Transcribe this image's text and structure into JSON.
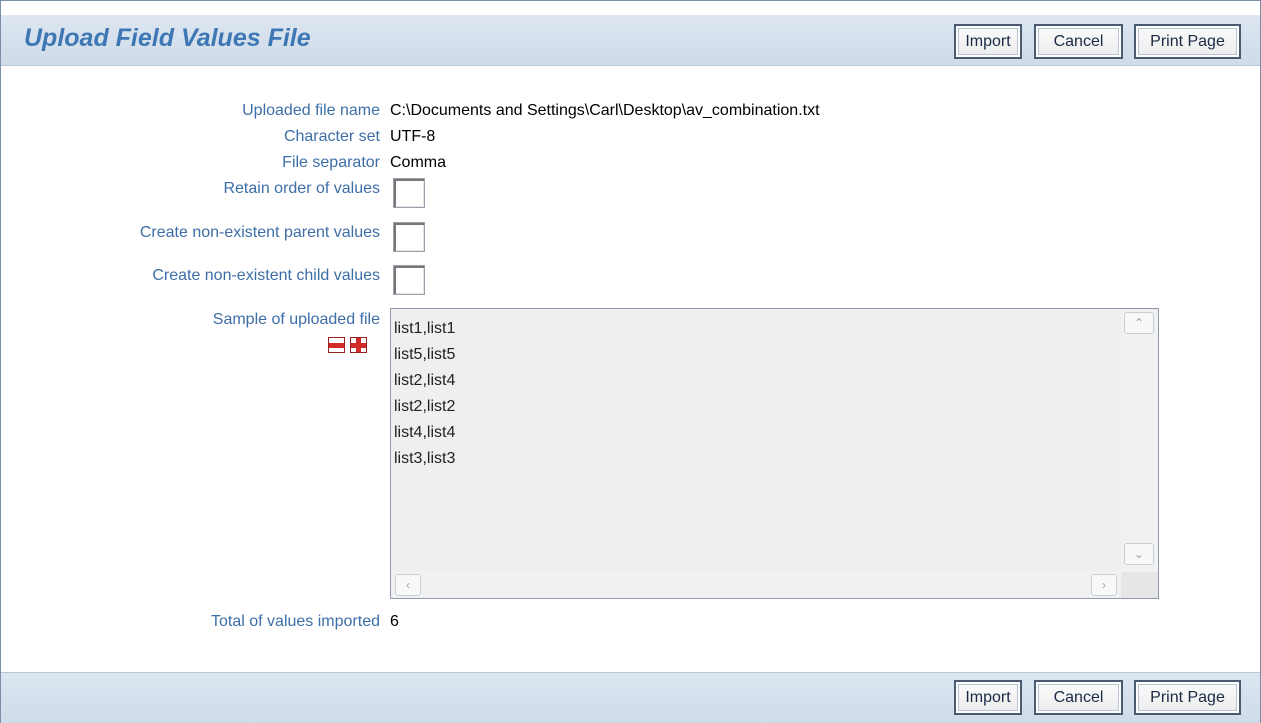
{
  "header": {
    "title": "Upload Field Values File",
    "import_label": "Import",
    "cancel_label": "Cancel",
    "print_label": "Print Page"
  },
  "form": {
    "uploaded_file_name": {
      "label": "Uploaded file name",
      "value": "C:\\Documents and Settings\\Carl\\Desktop\\av_combination.txt"
    },
    "character_set": {
      "label": "Character set",
      "value": "UTF-8"
    },
    "file_separator": {
      "label": "File separator",
      "value": "Comma"
    },
    "retain_order": {
      "label": "Retain order of values",
      "checked": false
    },
    "create_parent": {
      "label": "Create non-existent parent values",
      "checked": false
    },
    "create_child": {
      "label": "Create non-existent child values",
      "checked": false
    },
    "sample": {
      "label": "Sample of uploaded file",
      "lines": [
        "list1,list1",
        "list5,list5",
        "list2,list4",
        "list2,list2",
        "list4,list4",
        "list3,list3"
      ]
    },
    "total_imported": {
      "label": "Total of values imported",
      "value": "6"
    }
  },
  "footer": {
    "import_label": "Import",
    "cancel_label": "Cancel",
    "print_label": "Print Page"
  },
  "icons": {
    "collapse": "minus-icon",
    "expand": "plus-icon",
    "scroll_up": "chevron-up-icon",
    "scroll_down": "chevron-down-icon",
    "scroll_left": "chevron-left-icon",
    "scroll_right": "chevron-right-icon"
  },
  "colors": {
    "title": "#3d78b5",
    "label": "#3d6ea8",
    "bar": "#d5e0ed",
    "icon_red": "#d42a2a"
  }
}
